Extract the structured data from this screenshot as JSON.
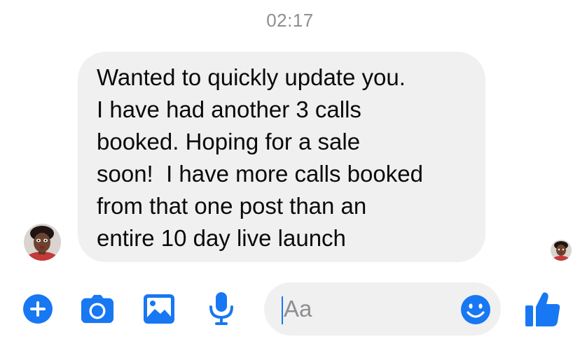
{
  "thread": {
    "timestamp": "02:17",
    "message": {
      "lines": [
        "Wanted to quickly update you.",
        "I have had another 3 calls",
        "booked. Hoping for a sale",
        "soon!  I have more calls booked",
        "from that one post than an",
        "entire 10 day live launch"
      ]
    }
  },
  "composer": {
    "placeholder": "Aa",
    "icons": [
      "plus-icon",
      "camera-icon",
      "image-icon",
      "microphone-icon",
      "emoji-icon",
      "thumbs-up-icon"
    ],
    "accent_color": "#1877f2"
  },
  "colors": {
    "bubble_bg": "#f0f0f0",
    "timestamp": "#8e8e93",
    "text": "#0a0a0a"
  }
}
